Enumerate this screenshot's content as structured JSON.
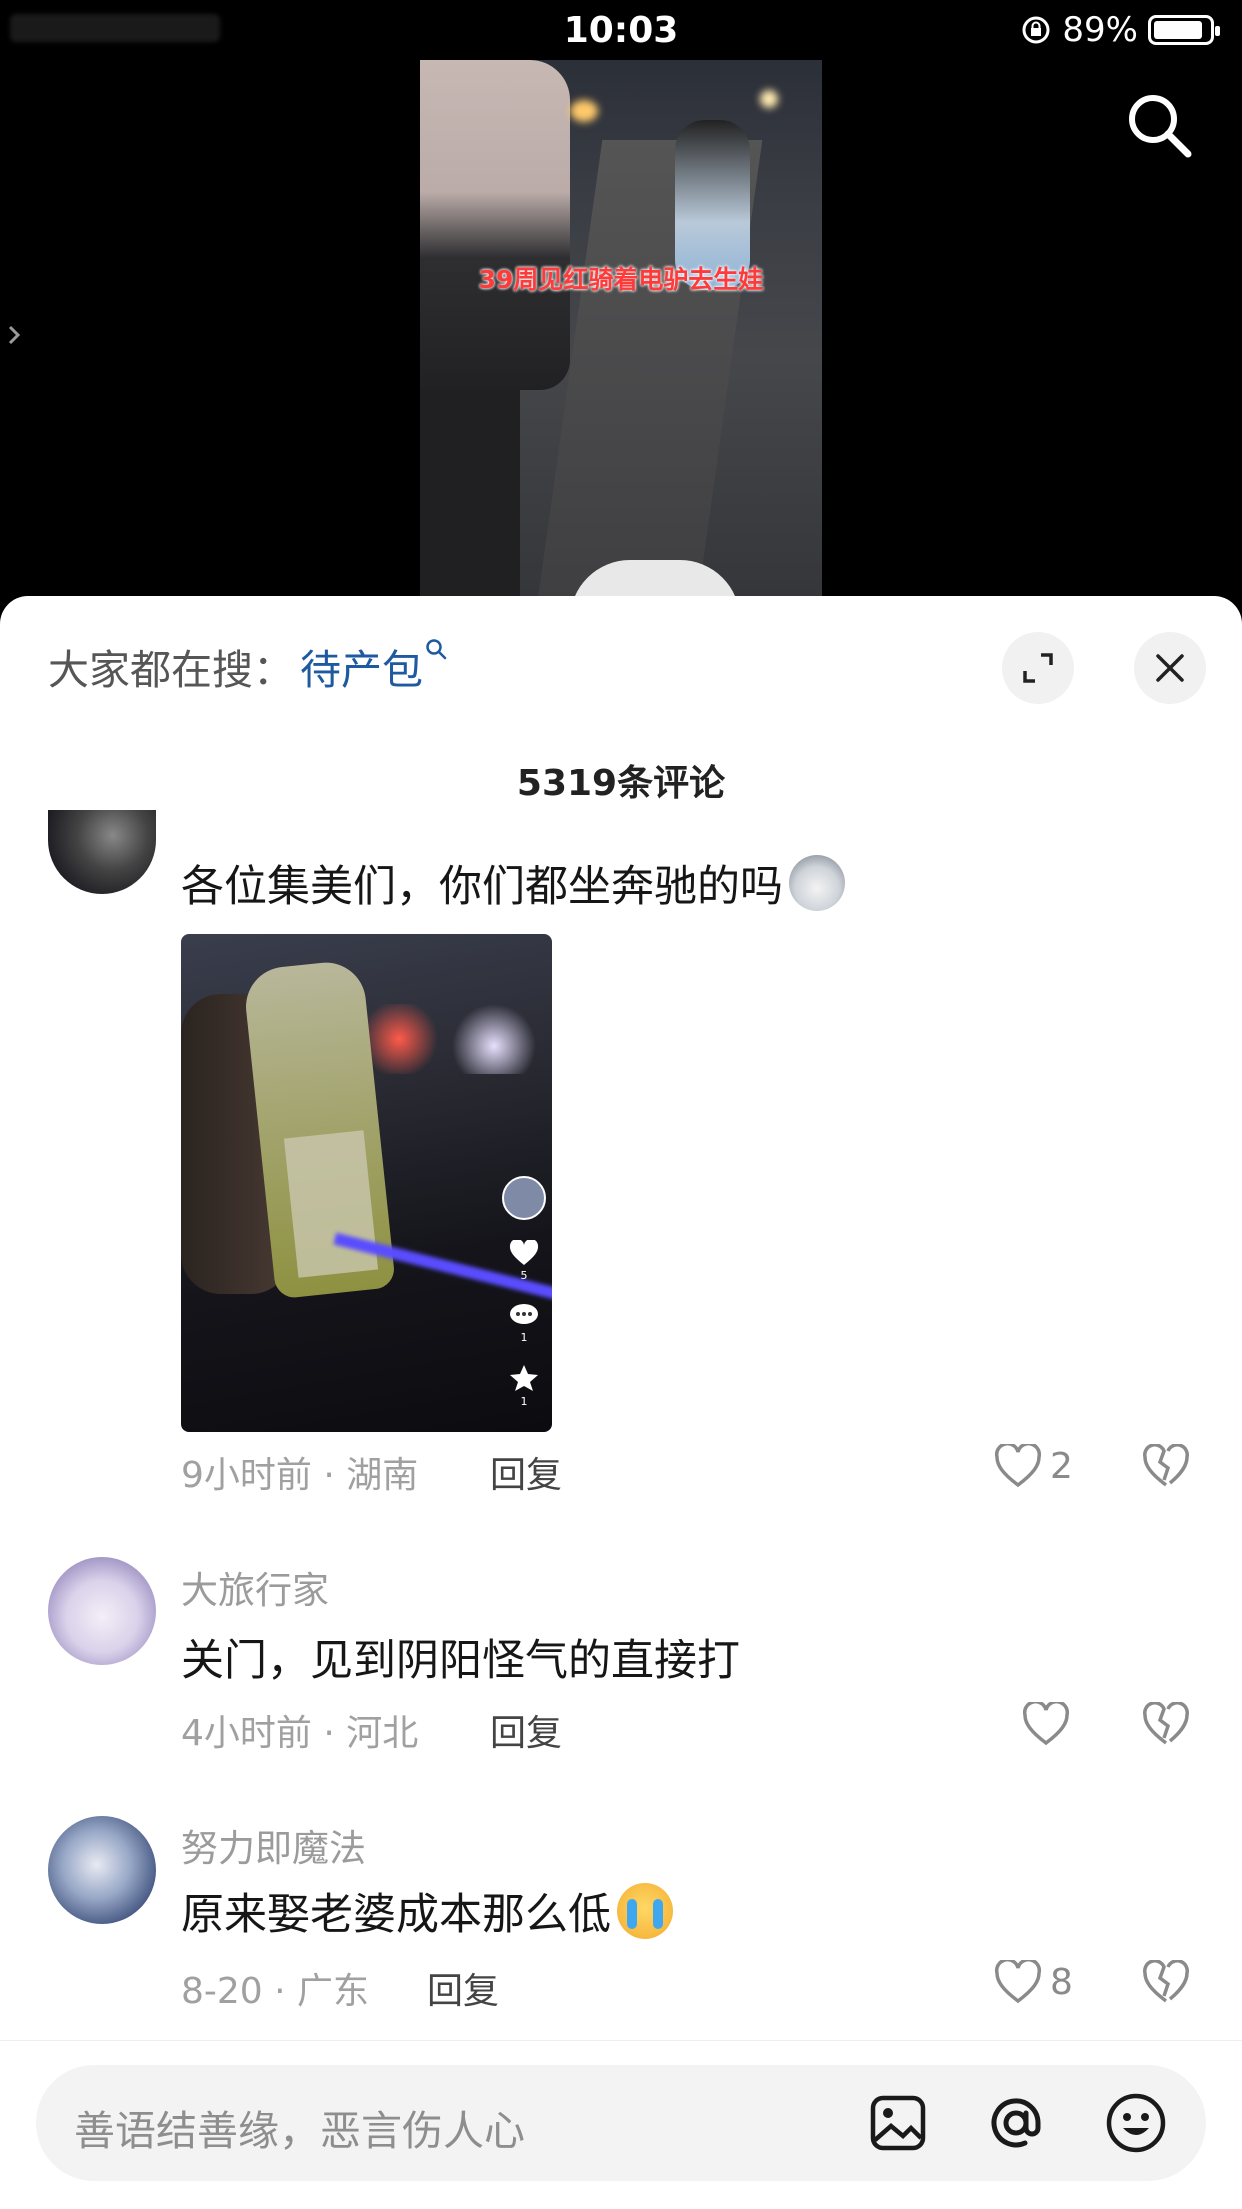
{
  "status_bar": {
    "time": "10:03",
    "battery_percent": "89%",
    "battery_level": 0.89
  },
  "video": {
    "caption": "39周见红骑着电驴去生娃"
  },
  "sheet": {
    "hot_search_prefix": "大家都在搜：",
    "hot_search_term": "待产包",
    "comment_count": "5319条评论"
  },
  "comments": [
    {
      "text": "各位集美们，你们都坐奔驰的吗",
      "emoji": "wolf-emoji",
      "image_like_count": "5",
      "image_comment_count": "1",
      "image_star_count": "1",
      "time_location": "9小时前 · 湖南",
      "reply": "回复",
      "likes": "2"
    },
    {
      "username": "大旅行家",
      "text": "关门，见到阴阳怪气的直接打",
      "time_location": "4小时前 · 河北",
      "reply": "回复",
      "likes": ""
    },
    {
      "username": "努力即魔法",
      "text": "原来娶老婆成本那么低",
      "emoji": "crying-emoji",
      "time_location": "8-20 · 广东",
      "reply": "回复",
      "likes": "8"
    }
  ],
  "input": {
    "placeholder": "善语结善缘，恶言伤人心"
  },
  "colors": {
    "link_blue": "#1e5aa0",
    "sheet_bg": "#ffffff",
    "input_bg": "#f3f3f3"
  }
}
